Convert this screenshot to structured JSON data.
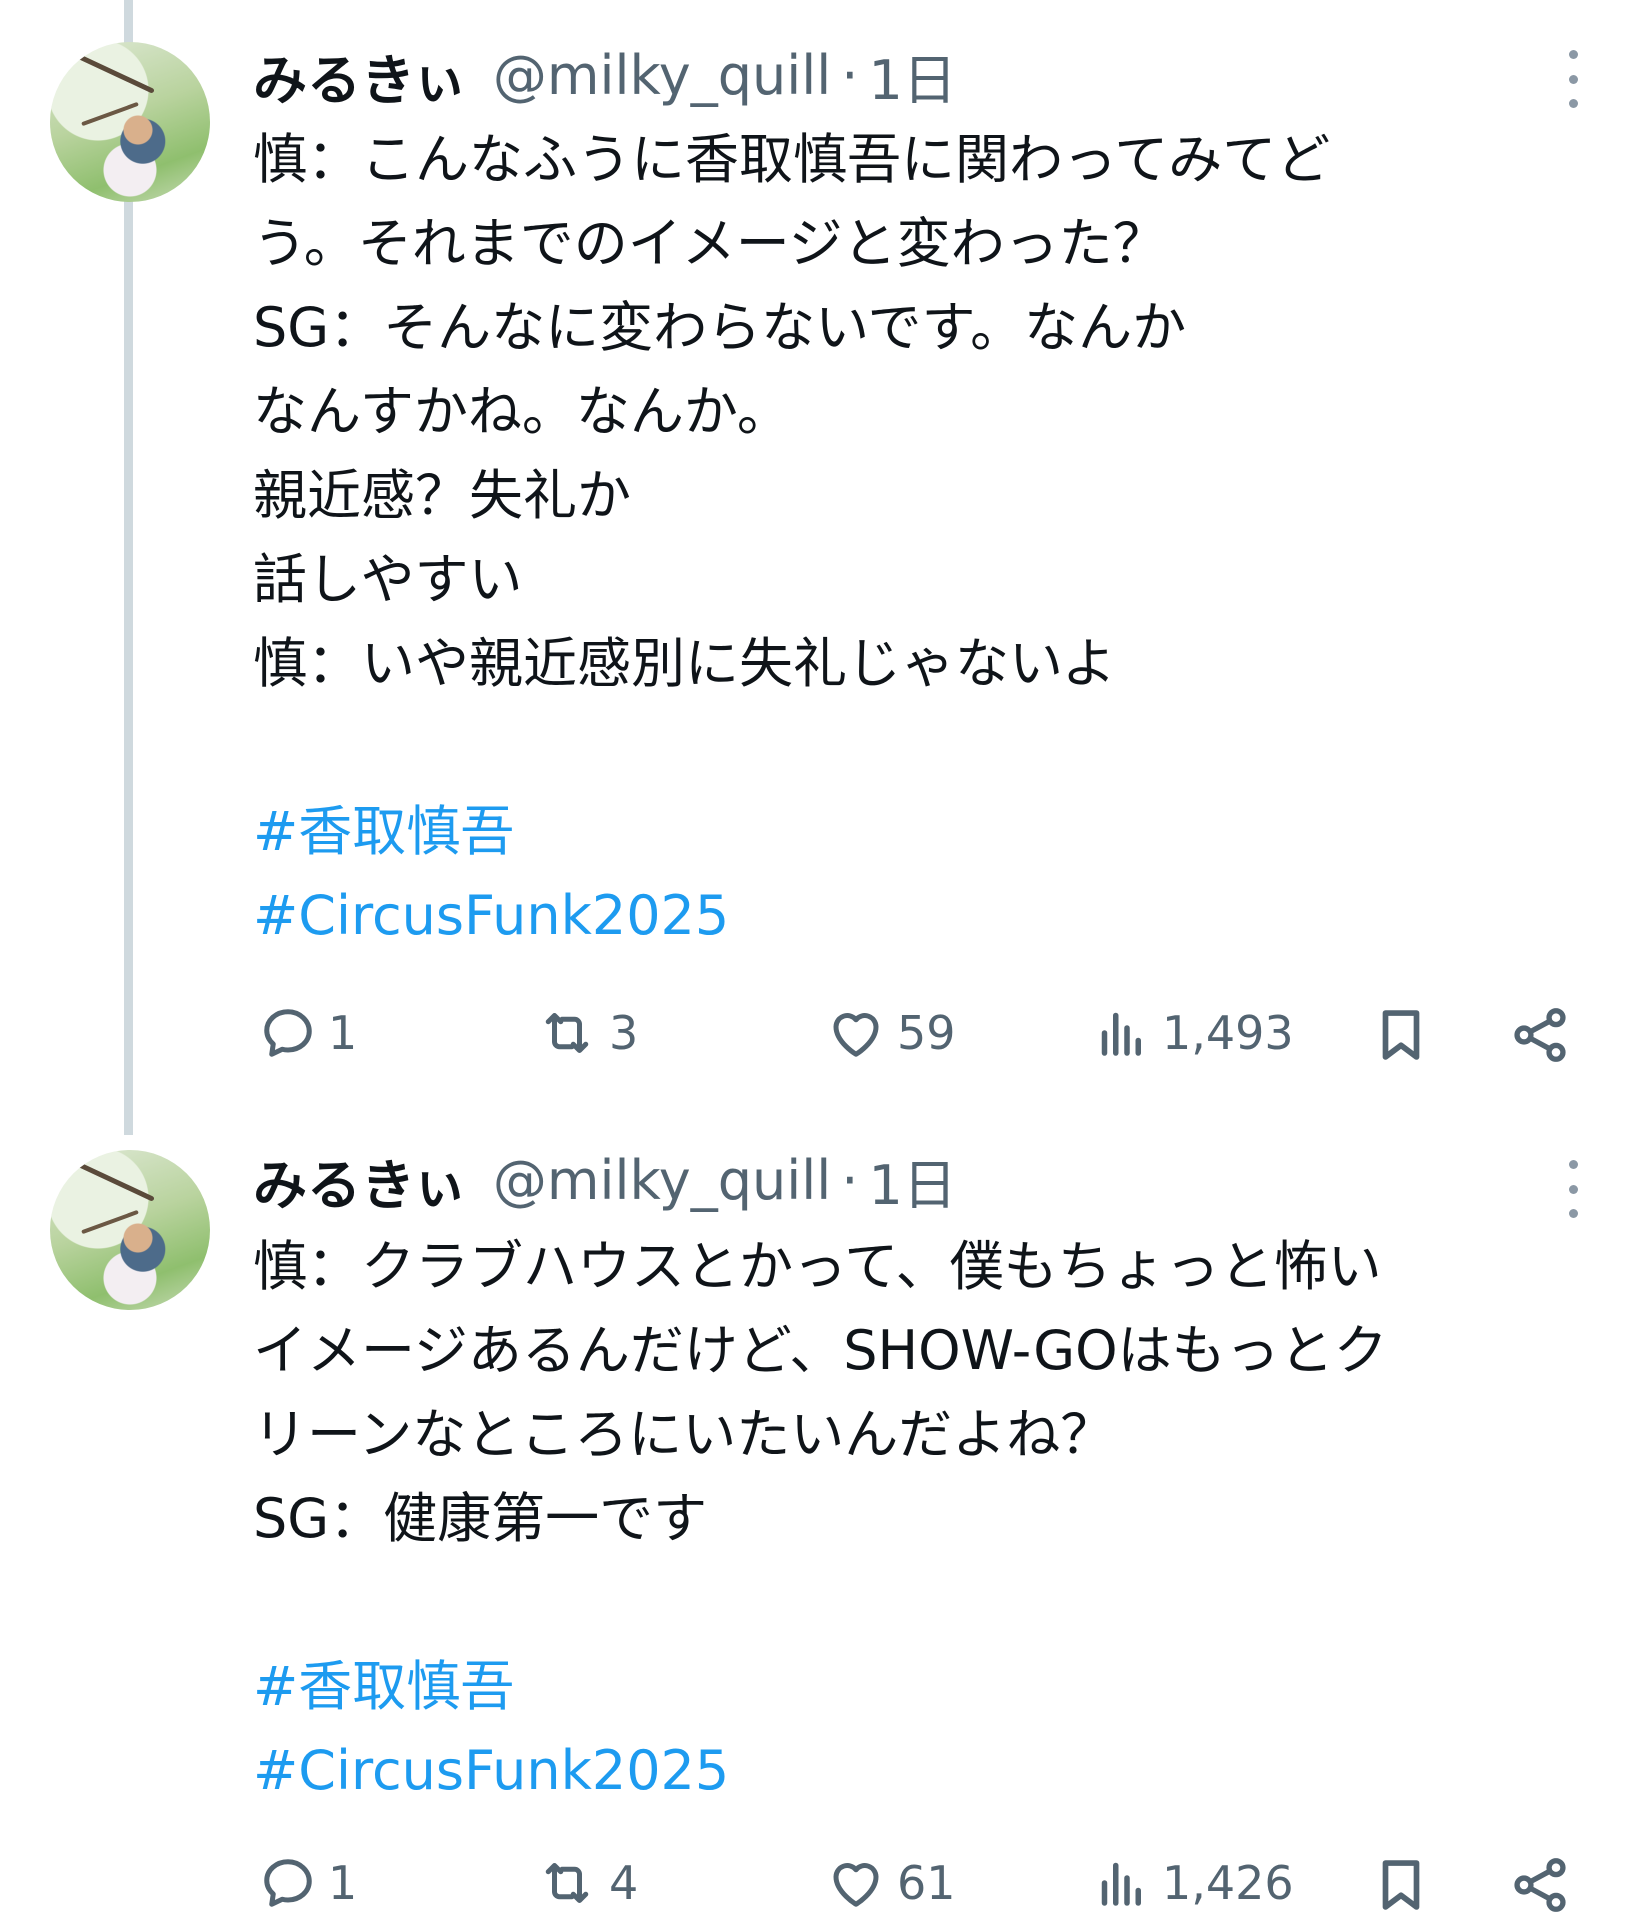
{
  "tweets": [
    {
      "name": "みるきぃ",
      "handle": "@milky_quill",
      "separator": "·",
      "time": "1日",
      "lines": [
        "慎：こんなふうに香取慎吾に関わってみてど",
        "う。それまでのイメージと変わった？",
        "SG：そんなに変わらないです。なんか",
        "なんすかね。なんか。",
        "親近感？失礼か",
        "話しやすい",
        "慎：いや親近感別に失礼じゃないよ"
      ],
      "hashtags": [
        "#香取慎吾",
        "#CircusFunk2025"
      ],
      "replies": "1",
      "retweets": "3",
      "likes": "59",
      "views": "1,493"
    },
    {
      "name": "みるきぃ",
      "handle": "@milky_quill",
      "separator": "·",
      "time": "1日",
      "lines": [
        "慎：クラブハウスとかって、僕もちょっと怖い",
        "イメージあるんだけど、SHOW-GOはもっとク",
        "リーンなところにいたいんだよね？",
        "SG：健康第一です"
      ],
      "hashtags": [
        "#香取慎吾",
        "#CircusFunk2025"
      ],
      "replies": "1",
      "retweets": "4",
      "likes": "61",
      "views": "1,426"
    }
  ],
  "icons": {
    "reply": "reply-icon",
    "retweet": "retweet-icon",
    "like": "heart-icon",
    "views": "views-icon",
    "bookmark": "bookmark-icon",
    "share": "share-icon",
    "more": "more-vertical-icon"
  },
  "colors": {
    "text": "#0f1419",
    "secondary": "#536471",
    "link": "#1d9bf0",
    "thread_line": "#cfd9de"
  }
}
